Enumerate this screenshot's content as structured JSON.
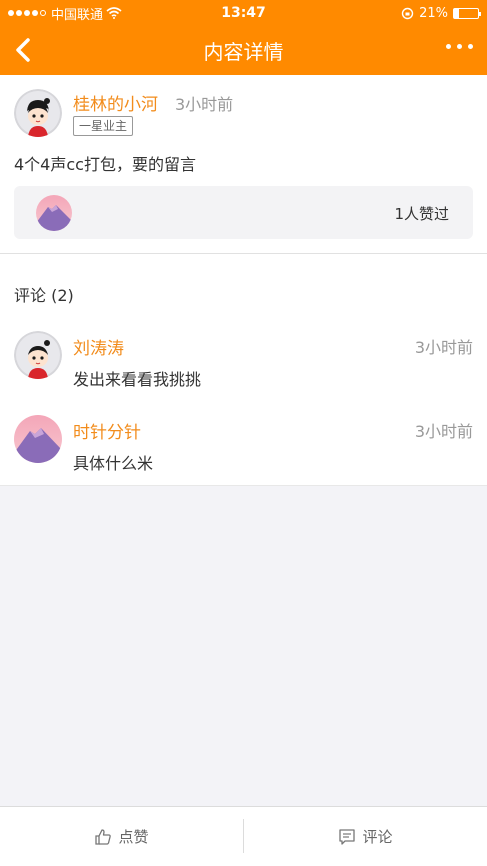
{
  "status_bar": {
    "carrier": "中国联通",
    "time": "13:47",
    "battery": "21%",
    "battery_level": 0.21
  },
  "nav": {
    "title": "内容详情",
    "back_icon": "chevron-left-icon",
    "more_icon": "more-dots-icon"
  },
  "post": {
    "author": "桂林的小河",
    "time": "3小时前",
    "badge": "一星业主",
    "content": "4个4声cc打包，要的留言",
    "like_count_text": "1人赞过"
  },
  "comments": {
    "title": "评论 (2)",
    "items": [
      {
        "author": "刘涛涛",
        "time": "3小时前",
        "text": "发出来看看我挑挑"
      },
      {
        "author": "时针分针",
        "time": "3小时前",
        "text": "具体什么米"
      }
    ]
  },
  "bottom_bar": {
    "like_label": "点赞",
    "comment_label": "评论"
  },
  "colors": {
    "accent": "#ff8a00",
    "author_name": "#f28c1c",
    "background": "#f3f3f7"
  }
}
